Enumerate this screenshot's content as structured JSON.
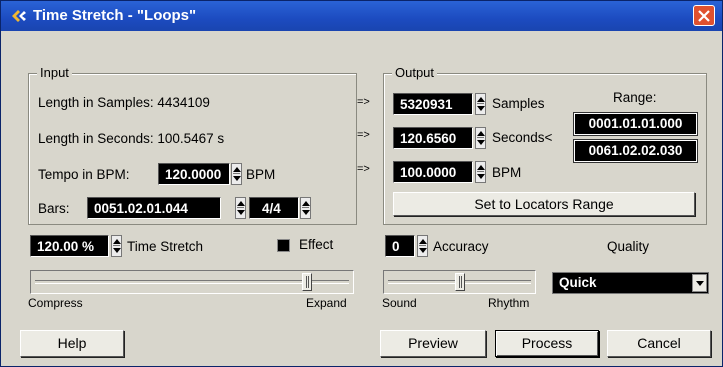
{
  "window": {
    "title": "Time Stretch - \"Loops\""
  },
  "input": {
    "group_label": "Input",
    "length_samples_label": "Length in Samples: 4434109",
    "length_seconds_label": "Length in Seconds: 100.5467 s",
    "tempo_label": "Tempo in BPM:",
    "tempo_value": "120.0000",
    "tempo_unit": "BPM",
    "bars_label": "Bars:",
    "bars_value": "0051.02.01.044",
    "signature_value": "4/4"
  },
  "arrows": [
    "=>",
    "=>",
    "=>"
  ],
  "output": {
    "group_label": "Output",
    "samples_value": "5320931",
    "samples_unit": "Samples",
    "seconds_value": "120.6560",
    "seconds_unit": "Seconds<",
    "bpm_value": "100.0000",
    "bpm_unit": "BPM",
    "range_label": "Range:",
    "range_start": "0001.01.01.000",
    "range_end": "0061.02.02.030",
    "set_locators_button": "Set to Locators Range"
  },
  "stretch": {
    "value": "120.00 %",
    "label": "Time Stretch",
    "effect_label": "Effect",
    "effect_checked": true,
    "slider_min_label": "Compress",
    "slider_max_label": "Expand",
    "slider_level": 0.87
  },
  "accuracy": {
    "value": "0",
    "label": "Accuracy",
    "slider_min_label": "Sound",
    "slider_max_label": "Rhythm",
    "slider_level": 0.5
  },
  "quality": {
    "label": "Quality",
    "selected": "Quick"
  },
  "buttons": {
    "help": "Help",
    "preview": "Preview",
    "process": "Process",
    "cancel": "Cancel"
  },
  "colors": {
    "titlebar": "#1c4bc0",
    "dialog_bg": "#d8d6cc",
    "field_bg": "#000000",
    "close_button": "#e0512f"
  }
}
